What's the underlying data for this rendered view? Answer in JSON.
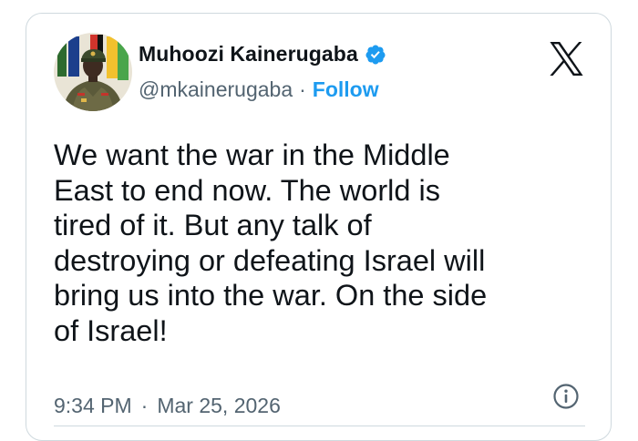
{
  "user": {
    "display_name": "Muhoozi Kainerugaba",
    "handle": "@mkainerugaba",
    "separator": "·",
    "follow_label": "Follow",
    "verified": true,
    "verified_color": "#1d9bf0"
  },
  "tweet": {
    "text": "We want the war in the Middle\nEast to end now. The world is\ntired of it. But any talk of\ndestroying or defeating Israel will\nbring us into the war. On the side\nof Israel!",
    "time": "9:34 PM",
    "separator": "·",
    "date": "Mar 25, 2026"
  },
  "icons": {
    "brand": "x-logo-icon",
    "badge": "verified-badge-icon",
    "info": "info-icon"
  },
  "colors": {
    "text": "#0f1419",
    "secondary": "#536471",
    "accent": "#1d9bf0",
    "border": "#cfd9de"
  }
}
